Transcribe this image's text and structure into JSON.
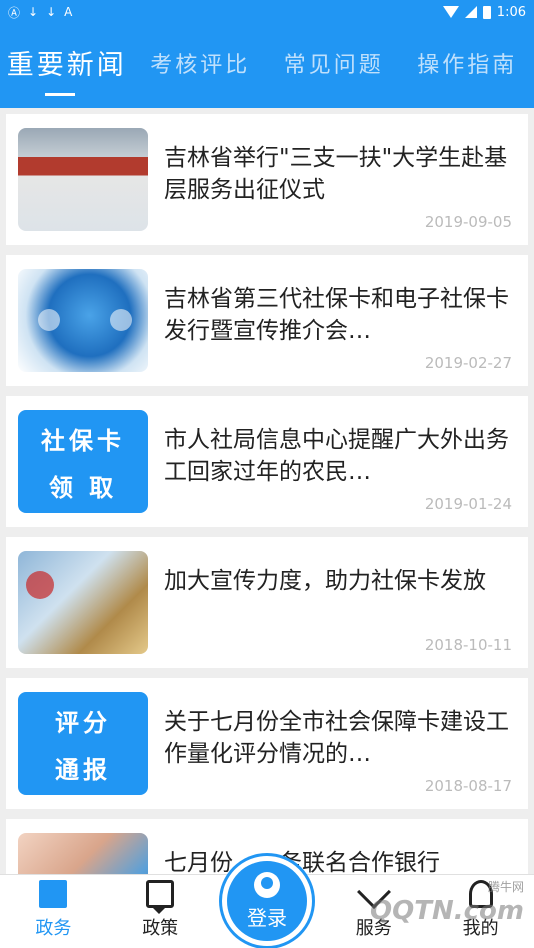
{
  "status_bar": {
    "left_icons": [
      "Ⓐ",
      "↓",
      "↓",
      "A"
    ],
    "time": "1:06"
  },
  "tabs": [
    {
      "label": "重要新闻",
      "active": true
    },
    {
      "label": "考核评比",
      "active": false
    },
    {
      "label": "常见问题",
      "active": false
    },
    {
      "label": "操作指南",
      "active": false
    }
  ],
  "news": [
    {
      "title": "吉林省举行\"三支一扶\"大学生赴基层服务出征仪式",
      "date": "2019-09-05",
      "thumb": "photo"
    },
    {
      "title": "吉林省第三代社保卡和电子社保卡发行暨宣传推介会…",
      "date": "2019-02-27",
      "thumb": "photo"
    },
    {
      "title": "市人社局信息中心提醒广大外出务工回家过年的农民…",
      "date": "2019-01-24",
      "thumb": "text",
      "thumb_lines": [
        "社保卡",
        "领  取"
      ]
    },
    {
      "title": "加大宣传力度，助力社保卡发放",
      "date": "2018-10-11",
      "thumb": "photo"
    },
    {
      "title": "关于七月份全市社会保障卡建设工作量化评分情况的…",
      "date": "2018-08-17",
      "thumb": "text",
      "thumb_lines": [
        "评分",
        "通报"
      ]
    },
    {
      "title": "七月份……务联名合作银行",
      "date": "",
      "thumb": "photo"
    }
  ],
  "bottom_nav": {
    "items": [
      {
        "label": "政务",
        "icon": "gov-icon",
        "active": true
      },
      {
        "label": "政策",
        "icon": "policy-icon",
        "active": false
      },
      {
        "label": "服务",
        "icon": "heart-icon",
        "active": false
      },
      {
        "label": "我的",
        "icon": "user-icon",
        "active": false
      }
    ],
    "login_label": "登录"
  },
  "watermark": {
    "text": "QQTN.com",
    "small": "腾牛网"
  },
  "colors": {
    "primary": "#2196f3"
  }
}
